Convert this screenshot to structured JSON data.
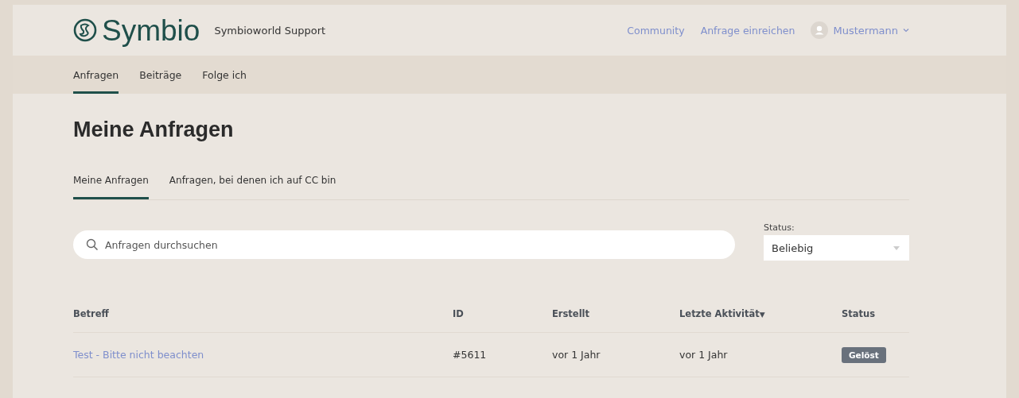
{
  "header": {
    "logo_text": "Symbio",
    "site_title": "Symbioworld Support",
    "links": [
      "Community",
      "Anfrage einreichen"
    ],
    "user": "Mustermann"
  },
  "nav_tabs": [
    {
      "label": "Anfragen",
      "selected": true
    },
    {
      "label": "Beiträge",
      "selected": false
    },
    {
      "label": "Folge ich",
      "selected": false
    }
  ],
  "page_title": "Meine Anfragen",
  "sub_tabs": [
    {
      "label": "Meine Anfragen",
      "selected": true
    },
    {
      "label": "Anfragen, bei denen ich auf CC bin",
      "selected": false
    }
  ],
  "search": {
    "placeholder": "Anfragen durchsuchen"
  },
  "status_filter": {
    "label": "Status:",
    "value": "Beliebig"
  },
  "table": {
    "columns": [
      {
        "label": "Betreff"
      },
      {
        "label": "ID"
      },
      {
        "label": "Erstellt"
      },
      {
        "label": "Letzte Aktivität",
        "sort_indicator": "▼"
      },
      {
        "label": "Status"
      }
    ],
    "rows": [
      {
        "subject": "Test - Bitte nicht beachten",
        "id": "#5611",
        "created": "vor 1 Jahr",
        "last_activity": "vor 1 Jahr",
        "status": "Gelöst"
      }
    ]
  }
}
